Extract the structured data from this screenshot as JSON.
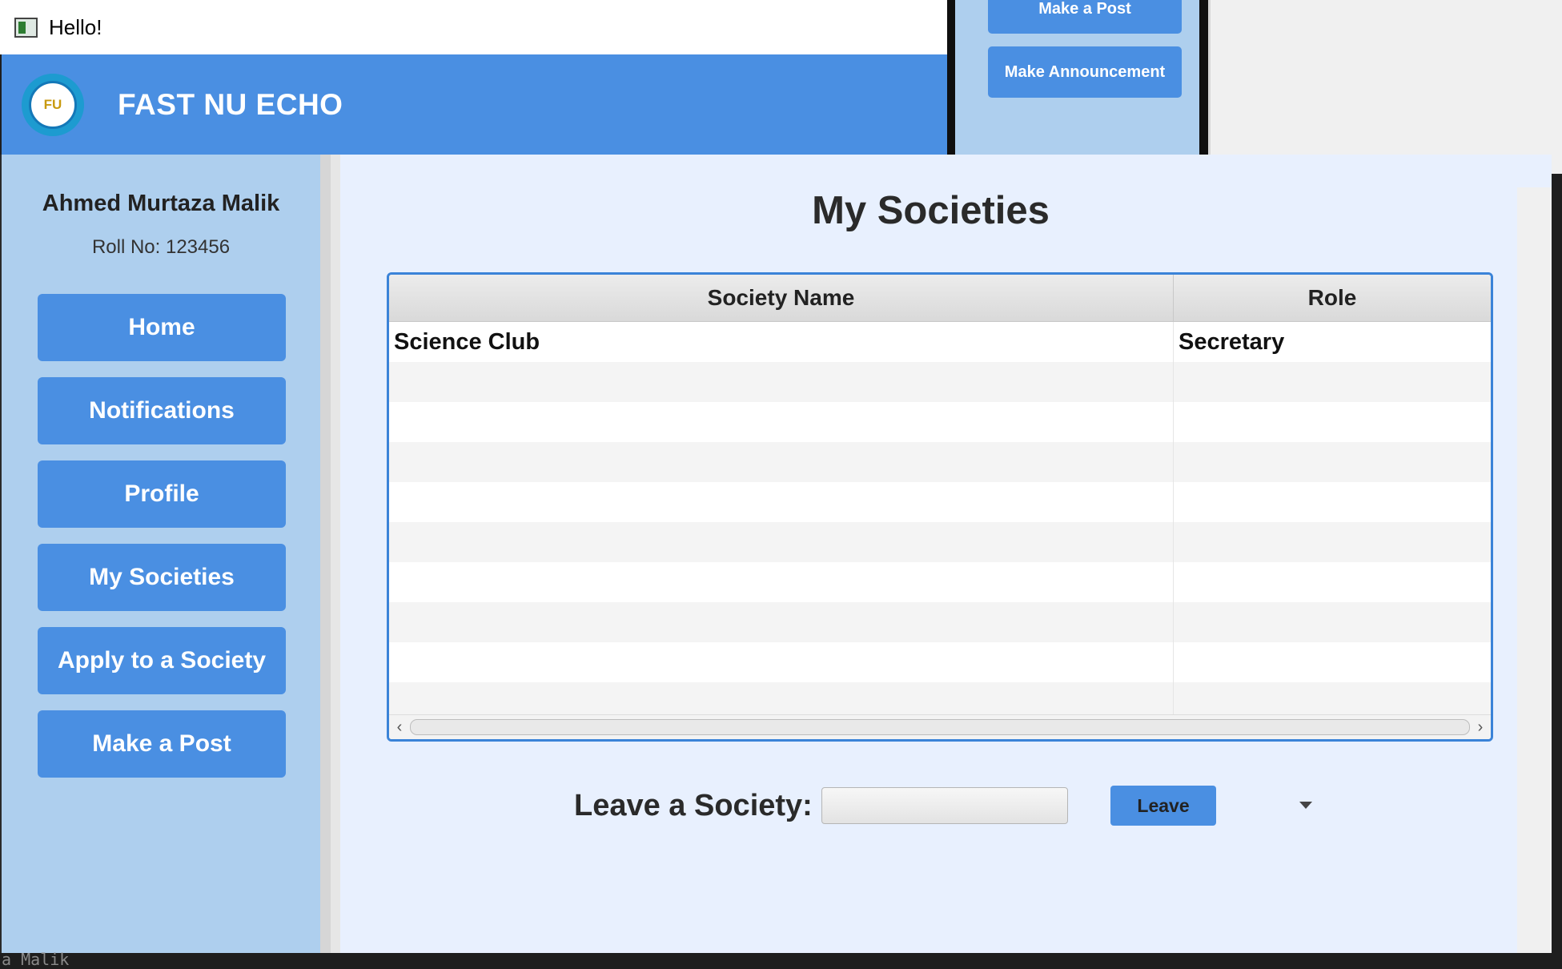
{
  "window": {
    "title": "Hello!"
  },
  "header": {
    "brand": "FAST NU ECHO",
    "logo_text": "FU"
  },
  "sidebar": {
    "user_name": "Ahmed Murtaza Malik",
    "roll": "Roll No: 123456",
    "items": [
      {
        "label": "Home"
      },
      {
        "label": "Notifications"
      },
      {
        "label": "Profile"
      },
      {
        "label": "My Societies"
      },
      {
        "label": "Apply to a Society"
      },
      {
        "label": "Make a Post"
      }
    ]
  },
  "main": {
    "title": "My Societies",
    "table": {
      "columns": [
        "Society Name",
        "Role"
      ],
      "rows": [
        {
          "society": "Science Club",
          "role": "Secretary"
        }
      ]
    },
    "leave": {
      "label": "Leave a Society:",
      "selected": "",
      "button": "Leave"
    }
  },
  "background_window": {
    "buttons": [
      "Make a Post",
      "Make Announcement"
    ]
  },
  "console": {
    "text": "a Malik"
  },
  "colors": {
    "accent": "#4a8fe2",
    "sidebar": "#aecfee",
    "content_bg": "#e8f0fe",
    "table_border": "#3a83d8"
  }
}
